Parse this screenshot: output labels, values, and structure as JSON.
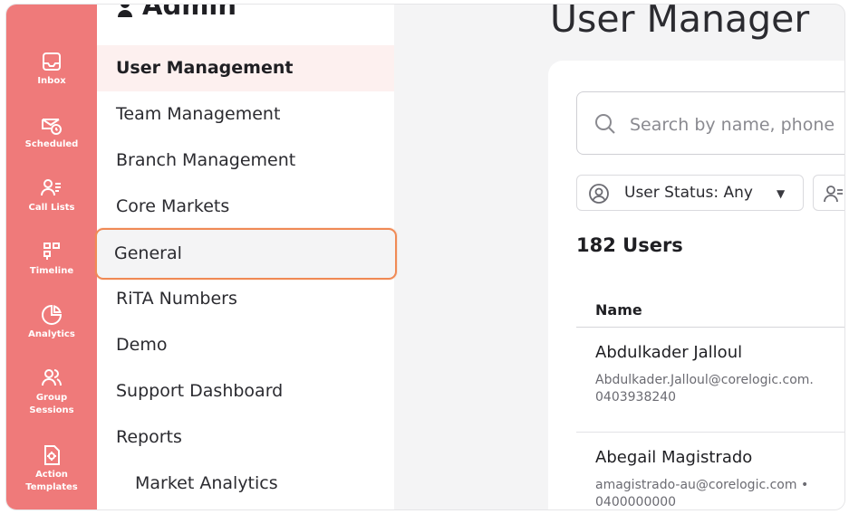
{
  "rail": {
    "items": [
      {
        "label": "Inbox",
        "icon": "inbox-icon"
      },
      {
        "label": "Scheduled",
        "icon": "scheduled-icon"
      },
      {
        "label": "Call Lists",
        "icon": "call-lists-icon"
      },
      {
        "label": "Timeline",
        "icon": "timeline-icon"
      },
      {
        "label": "Analytics",
        "icon": "analytics-icon"
      },
      {
        "label": "Group\nSessions",
        "icon": "group-sessions-icon"
      },
      {
        "label": "Action\nTemplates",
        "icon": "action-templates-icon"
      }
    ],
    "color": "#ef7a7a"
  },
  "sidebar": {
    "title": "Admin",
    "items": [
      {
        "label": "User Management",
        "active": true
      },
      {
        "label": "Team Management"
      },
      {
        "label": "Branch Management"
      },
      {
        "label": "Core Markets"
      },
      {
        "label": "General",
        "highlighted": true
      },
      {
        "label": "RiTA Numbers"
      },
      {
        "label": "Demo"
      },
      {
        "label": "Support Dashboard"
      },
      {
        "label": "Reports"
      },
      {
        "label": "Market Analytics",
        "sub": true
      }
    ]
  },
  "main": {
    "title": "User Manager",
    "search": {
      "placeholder": "Search by name, phone"
    },
    "filter": {
      "label": "User Status: Any"
    },
    "users_count": "182 Users",
    "table": {
      "header": "Name",
      "rows": [
        {
          "name": "Abdulkader Jalloul",
          "email": "Abdulkader.Jalloul@corelogic.com.",
          "phone": "0403938240"
        },
        {
          "name": "Abegail Magistrado",
          "email": "amagistrado-au@corelogic.com •",
          "phone": "0400000000"
        }
      ]
    }
  },
  "colors": {
    "accent": "#ef7a7a",
    "highlight_border": "#f08a55",
    "active_bg": "#fdf0ef"
  }
}
